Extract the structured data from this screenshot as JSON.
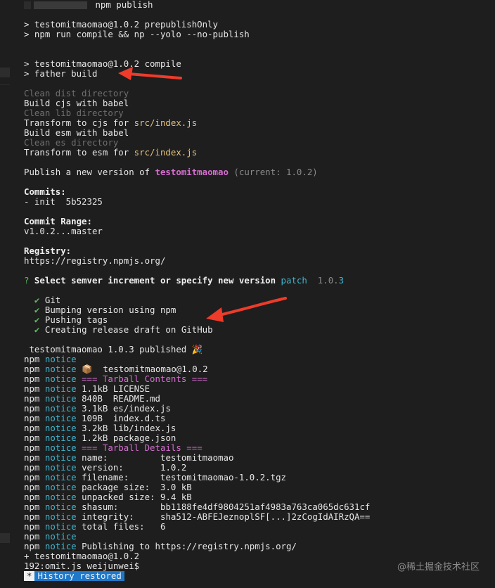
{
  "top_line": {
    "tail": " npm publish"
  },
  "lines": {
    "prepublish": "> testomitmaomao@1.0.2 prepublishOnly",
    "compile_np": "> npm run compile && np --yolo --no-publish",
    "compile": "> testomitmaomao@1.0.2 compile",
    "father": "> father build",
    "clean_dist": "Clean dist directory",
    "build_cjs": "Build cjs with babel",
    "clean_lib": "Clean lib directory",
    "transform_cjs_prefix": "Transform to cjs for ",
    "transform_cjs_path": "src/index.js",
    "build_esm": "Build esm with babel",
    "clean_es": "Clean es directory",
    "transform_esm_prefix": "Transform to esm for ",
    "transform_esm_path": "src/index.js",
    "publish_prefix": "Publish a new version of ",
    "publish_pkg": "testomitmaomao",
    "publish_current": " (current: 1.0.2)",
    "commits_label": "Commits:",
    "commit_entry": "- init  5b52325",
    "commit_range_label": "Commit Range:",
    "commit_range": "v1.0.2...master",
    "registry_label": "Registry:",
    "registry_url": "https://registry.npmjs.org/",
    "prompt_q": "?",
    "prompt_text": " Select semver increment or specify new version ",
    "prompt_answer": "patch",
    "prompt_version_main": "  1.0.",
    "prompt_version_last": "3",
    "task_git": "Git",
    "task_bump": "Bumping version using npm",
    "task_tags": "Pushing tags",
    "task_release": "Creating release draft on GitHub",
    "published": " testomitmaomao 1.0.3 published 🎉",
    "plus_pkg": "+ testomitmaomao@1.0.2",
    "shell_prompt": "192:omit.js weijunwei$"
  },
  "checkmark": "✔",
  "npm_notice": [
    {
      "npm": "npm",
      "notice": "notice",
      "text": ""
    },
    {
      "npm": "npm",
      "notice": "notice",
      "text": " 📦  testomitmaomao@1.0.2"
    },
    {
      "npm": "npm",
      "notice": "notice",
      "text": " === Tarball Contents ===",
      "style": "magenta"
    },
    {
      "npm": "npm",
      "notice": "notice",
      "text": " 1.1kB LICENSE"
    },
    {
      "npm": "npm",
      "notice": "notice",
      "text": " 840B  README.md"
    },
    {
      "npm": "npm",
      "notice": "notice",
      "text": " 3.1kB es/index.js"
    },
    {
      "npm": "npm",
      "notice": "notice",
      "text": " 109B  index.d.ts"
    },
    {
      "npm": "npm",
      "notice": "notice",
      "text": " 3.2kB lib/index.js"
    },
    {
      "npm": "npm",
      "notice": "notice",
      "text": " 1.2kB package.json"
    },
    {
      "npm": "npm",
      "notice": "notice",
      "text": " === Tarball Details ===",
      "style": "magenta"
    },
    {
      "npm": "npm",
      "notice": "notice",
      "text": " name:          testomitmaomao"
    },
    {
      "npm": "npm",
      "notice": "notice",
      "text": " version:       1.0.2"
    },
    {
      "npm": "npm",
      "notice": "notice",
      "text": " filename:      testomitmaomao-1.0.2.tgz"
    },
    {
      "npm": "npm",
      "notice": "notice",
      "text": " package size:  3.0 kB"
    },
    {
      "npm": "npm",
      "notice": "notice",
      "text": " unpacked size: 9.4 kB"
    },
    {
      "npm": "npm",
      "notice": "notice",
      "text": " shasum:        bb1188fe4df9804251af4983a763ca065dc631cf"
    },
    {
      "npm": "npm",
      "notice": "notice",
      "text": " integrity:     sha512-ABFEJeznoplSF[...]2zCogIdAIRzQA=="
    },
    {
      "npm": "npm",
      "notice": "notice",
      "text": " total files:   6"
    },
    {
      "npm": "npm",
      "notice": "notice",
      "text": ""
    },
    {
      "npm": "npm",
      "notice": "notice",
      "text": " Publishing to https://registry.npmjs.org/"
    }
  ],
  "status_bar": {
    "star": "*",
    "text": "History restored"
  },
  "watermark": "@稀土掘金技术社区",
  "colors": {
    "background": "#1e1e1e",
    "text": "#e6e6e6",
    "dim": "#6e6e6e",
    "path": "#e5c07b",
    "package": "#d56ed1",
    "notice": "#3fb6cf",
    "check": "#5fb85f",
    "arrow": "#ee3b2a",
    "status_bar": "#1f78c8"
  }
}
